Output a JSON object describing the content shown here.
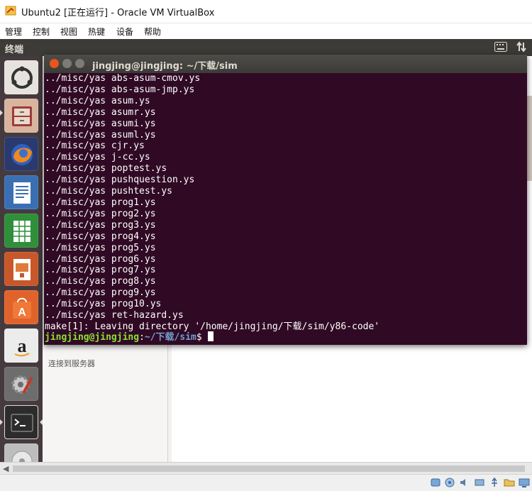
{
  "window": {
    "title": "Ubuntu2 [正在运行] - Oracle VM VirtualBox"
  },
  "menu": [
    "管理",
    "控制",
    "视图",
    "热键",
    "设备",
    "帮助"
  ],
  "ubuntu_panel": {
    "title": "终端"
  },
  "launcher": {
    "items": [
      "ubuntu-dash",
      "files",
      "firefox",
      "libreoffice-writer",
      "libreoffice-calc",
      "libreoffice-impress",
      "ubuntu-software",
      "amazon",
      "system-settings",
      "terminal",
      "dvd"
    ]
  },
  "background_app": {
    "partial_label": "连接到服务器"
  },
  "terminal": {
    "title": "jingjing@jingjing: ~/下载/sim",
    "lines": [
      "../misc/yas abs-asum-cmov.ys",
      "../misc/yas abs-asum-jmp.ys",
      "../misc/yas asum.ys",
      "../misc/yas asumr.ys",
      "../misc/yas asumi.ys",
      "../misc/yas asuml.ys",
      "../misc/yas cjr.ys",
      "../misc/yas j-cc.ys",
      "../misc/yas poptest.ys",
      "../misc/yas pushquestion.ys",
      "../misc/yas pushtest.ys",
      "../misc/yas prog1.ys",
      "../misc/yas prog2.ys",
      "../misc/yas prog3.ys",
      "../misc/yas prog4.ys",
      "../misc/yas prog5.ys",
      "../misc/yas prog6.ys",
      "../misc/yas prog7.ys",
      "../misc/yas prog8.ys",
      "../misc/yas prog9.ys",
      "../misc/yas prog10.ys",
      "../misc/yas ret-hazard.ys",
      "make[1]: Leaving directory '/home/jingjing/下载/sim/y86-code'"
    ],
    "prompt_user": "jingjing@jingjing",
    "prompt_sep": ":",
    "prompt_path": "~/下载/sim",
    "prompt_symbol": "$ "
  }
}
